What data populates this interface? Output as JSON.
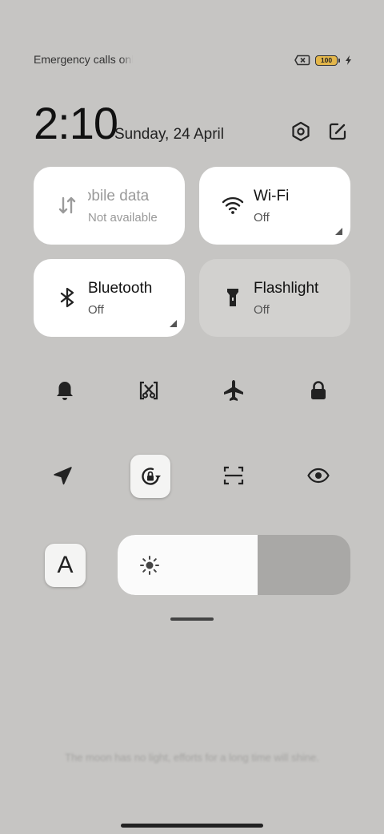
{
  "status": {
    "carrier_text": "Emergency calls only",
    "battery_level": "100",
    "icons": [
      "sim-disabled-icon",
      "battery-icon",
      "charging-bolt-icon"
    ]
  },
  "header": {
    "time": "2:10",
    "date": "Sunday, 24 April",
    "buttons": [
      "settings-icon",
      "edit-icon"
    ]
  },
  "tiles": {
    "mobile_data": {
      "title": "Mobile data",
      "status": "Not available",
      "icon": "mobile-data-icon"
    },
    "wifi": {
      "title": "Wi-Fi",
      "status": "Off",
      "icon": "wifi-icon"
    },
    "bluetooth": {
      "title": "Bluetooth",
      "status": "Off",
      "icon": "bluetooth-icon"
    },
    "flashlight": {
      "title": "Flashlight",
      "status": "Off",
      "icon": "flashlight-icon"
    }
  },
  "quick_toggles_row1": [
    "bell-icon",
    "screenshot-icon",
    "airplane-icon",
    "lock-icon"
  ],
  "quick_toggles_row2": [
    "location-icon",
    "auto-rotate-lock-icon",
    "scan-icon",
    "eye-icon"
  ],
  "font_button_label": "A",
  "brightness_level": 0.6,
  "quote": "The moon has no light, efforts for a long time will shine.",
  "colors": {
    "background": "#c6c5c3",
    "tile_on": "#ffffff",
    "tile_off": "#d2d1cf",
    "brightness_track": "#a9a8a6"
  }
}
